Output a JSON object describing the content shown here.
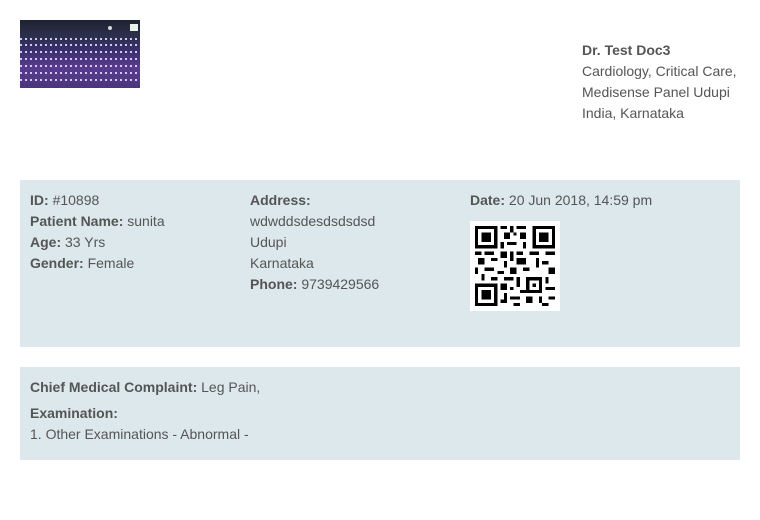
{
  "doctor": {
    "name": "Dr. Test Doc3",
    "specialties": "Cardiology, Critical Care,",
    "clinic": "Medisense Panel Udupi",
    "location": "India, Karnataka"
  },
  "patient": {
    "id_label": "ID:",
    "id_value": "#10898",
    "name_label": "Patient Name:",
    "name_value": "sunita",
    "age_label": "Age:",
    "age_value": "33 Yrs",
    "gender_label": "Gender:",
    "gender_value": "Female"
  },
  "address": {
    "label": "Address:",
    "line1": "wdwddsdesdsdsdsd",
    "city": "Udupi",
    "state": "Karnataka",
    "phone_label": "Phone:",
    "phone_value": "9739429566"
  },
  "visit": {
    "date_label": "Date:",
    "date_value": "20 Jun 2018, 14:59 pm"
  },
  "complaint": {
    "label": "Chief Medical Complaint:",
    "value": "Leg Pain,"
  },
  "examination": {
    "label": "Examination:",
    "item1": "1. Other Examinations - Abnormal -"
  },
  "colors": {
    "panel": "#dce8ec",
    "text": "#555555"
  }
}
